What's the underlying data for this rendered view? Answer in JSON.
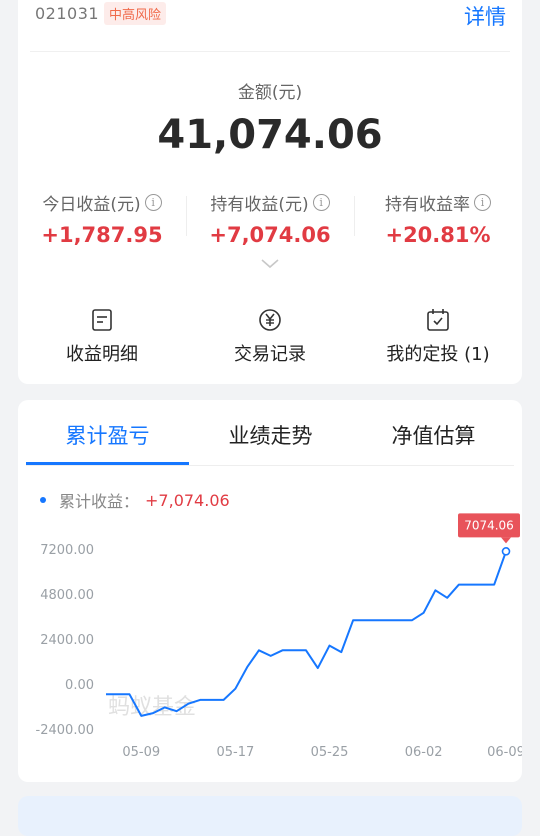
{
  "fund": {
    "code": "021031",
    "risk_tag": "中高风险",
    "detail_link": "详情"
  },
  "amount": {
    "label": "金额(元)",
    "value": "41,074.06"
  },
  "stats": [
    {
      "label": "今日收益(元)",
      "value": "+1,787.95"
    },
    {
      "label": "持有收益(元)",
      "value": "+7,074.06"
    },
    {
      "label": "持有收益率",
      "value": "+20.81%"
    }
  ],
  "actions": [
    {
      "label": "收益明细",
      "icon": "document-icon"
    },
    {
      "label": "交易记录",
      "icon": "yen-circle-icon"
    },
    {
      "label": "我的定投 (1)",
      "icon": "calendar-check-icon"
    }
  ],
  "tabs": [
    {
      "label": "累计盈亏",
      "active": true
    },
    {
      "label": "业绩走势",
      "active": false
    },
    {
      "label": "净值估算",
      "active": false
    }
  ],
  "legend": {
    "label": "累计收益：",
    "value": "+7,074.06"
  },
  "watermark": "蚂蚁基金",
  "colors": {
    "accent": "#1677ff",
    "gain": "#e13b43",
    "risk_text": "#f06a4a",
    "tooltip_bg": "#e8535a"
  },
  "chart_data": {
    "type": "line",
    "x_ticks": [
      "05-09",
      "05-17",
      "05-25",
      "06-02",
      "06-09"
    ],
    "y_ticks": [
      "7200.00",
      "4800.00",
      "2400.00",
      "0.00",
      "-2400.00"
    ],
    "ylim": [
      -2400,
      7200
    ],
    "grid": false,
    "series": [
      {
        "name": "累计收益",
        "x": [
          "05-06",
          "05-07",
          "05-08",
          "05-09",
          "05-10",
          "05-11",
          "05-12",
          "05-13",
          "05-14",
          "05-15",
          "05-16",
          "05-17",
          "05-18",
          "05-19",
          "05-20",
          "05-21",
          "05-22",
          "05-23",
          "05-24",
          "05-25",
          "05-26",
          "05-27",
          "05-28",
          "05-29",
          "05-30",
          "05-31",
          "06-01",
          "06-02",
          "06-03",
          "06-04",
          "06-05",
          "06-06",
          "06-07",
          "06-08",
          "06-09"
        ],
        "values": [
          -550,
          -550,
          -550,
          -1700,
          -1550,
          -1250,
          -1450,
          -1050,
          -850,
          -850,
          -850,
          -250,
          900,
          1800,
          1500,
          1800,
          1800,
          1800,
          850,
          2050,
          1700,
          3400,
          3400,
          3400,
          3400,
          3400,
          3400,
          3800,
          5000,
          4600,
          5300,
          5300,
          5300,
          5300,
          7074.06
        ]
      }
    ],
    "tooltip": "7074.06"
  }
}
